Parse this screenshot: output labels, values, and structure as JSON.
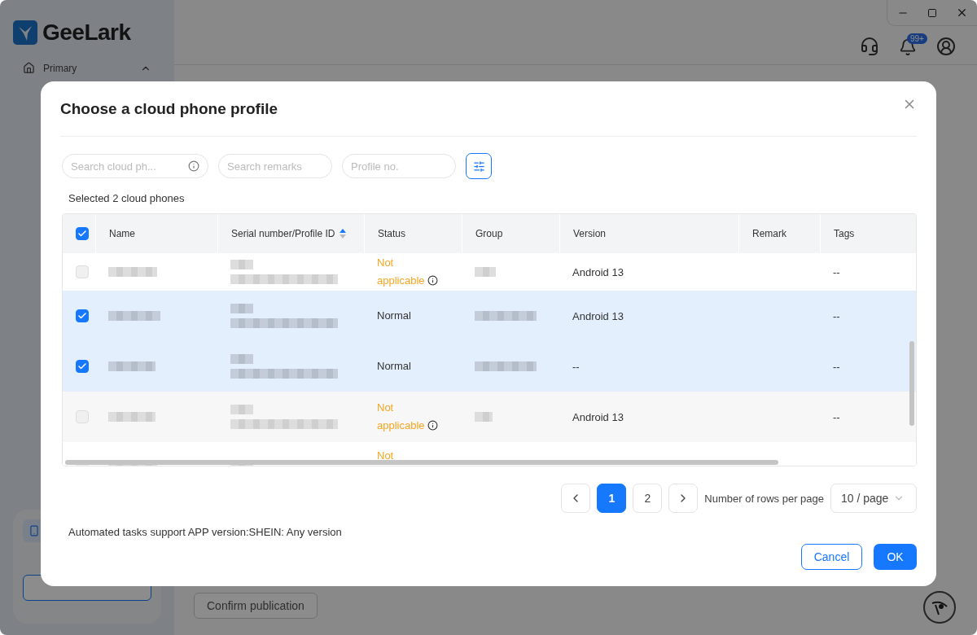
{
  "app": {
    "brand": "GeeLark",
    "nav": [
      {
        "label": "Primary",
        "expanded": true
      }
    ],
    "notifications_badge": "99+",
    "confirm_button": "Confirm publication"
  },
  "dialog": {
    "title": "Choose a cloud phone profile",
    "filters": [
      {
        "placeholder": "Search cloud ph...",
        "info": true
      },
      {
        "placeholder": "Search remarks",
        "info": false
      },
      {
        "placeholder": "Profile no.",
        "info": false
      }
    ],
    "selection_summary": "Selected 2 cloud phones",
    "table": {
      "all_checked": true,
      "columns": [
        {
          "label": "Name"
        },
        {
          "label": "Serial number/Profile ID",
          "sortable": true
        },
        {
          "label": "Status"
        },
        {
          "label": "Group"
        },
        {
          "label": "Version"
        },
        {
          "label": "Remark"
        },
        {
          "label": "Tags"
        }
      ],
      "rows": [
        {
          "selected": false,
          "disabled": true,
          "status": "Not applicable",
          "applicable": false,
          "version": "Android 13",
          "tags": "--"
        },
        {
          "selected": true,
          "disabled": false,
          "status": "Normal",
          "applicable": true,
          "version": "Android 13",
          "tags": "--"
        },
        {
          "selected": true,
          "disabled": false,
          "status": "Normal",
          "applicable": true,
          "version": "--",
          "tags": "--"
        },
        {
          "selected": false,
          "disabled": true,
          "status": "Not applicable",
          "applicable": false,
          "version": "Android 13",
          "tags": "--"
        },
        {
          "selected": false,
          "disabled": true,
          "status": "Not",
          "applicable": false
        }
      ]
    },
    "pagination": {
      "pages": [
        {
          "label": "1",
          "selected": true
        },
        {
          "label": "2",
          "selected": false
        }
      ],
      "rows_per_page_label": "Number of rows per page",
      "page_size": "10 / page"
    },
    "note": "Automated tasks support APP version:SHEIN: Any version",
    "buttons": {
      "cancel": "Cancel",
      "ok": "OK"
    }
  }
}
